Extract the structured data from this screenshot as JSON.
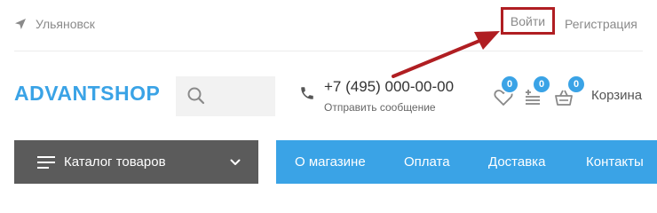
{
  "top": {
    "city": "Ульяновск",
    "login": "Войти",
    "register": "Регистрация"
  },
  "header": {
    "logo": "ADVANTSHOP",
    "search_value": "",
    "phone": "+7 (495) 000-00-00",
    "send_message": "Отправить сообщение",
    "wishlist_count": "0",
    "compare_count": "0",
    "cart_count": "0",
    "cart_label": "Корзина"
  },
  "nav": {
    "catalog": "Каталог товаров",
    "menu": [
      "О магазине",
      "Оплата",
      "Доставка",
      "Контакты"
    ]
  },
  "colors": {
    "accent": "#3aa3e6",
    "catalog_bg": "#5b5b5b",
    "highlight": "#b01e22"
  }
}
